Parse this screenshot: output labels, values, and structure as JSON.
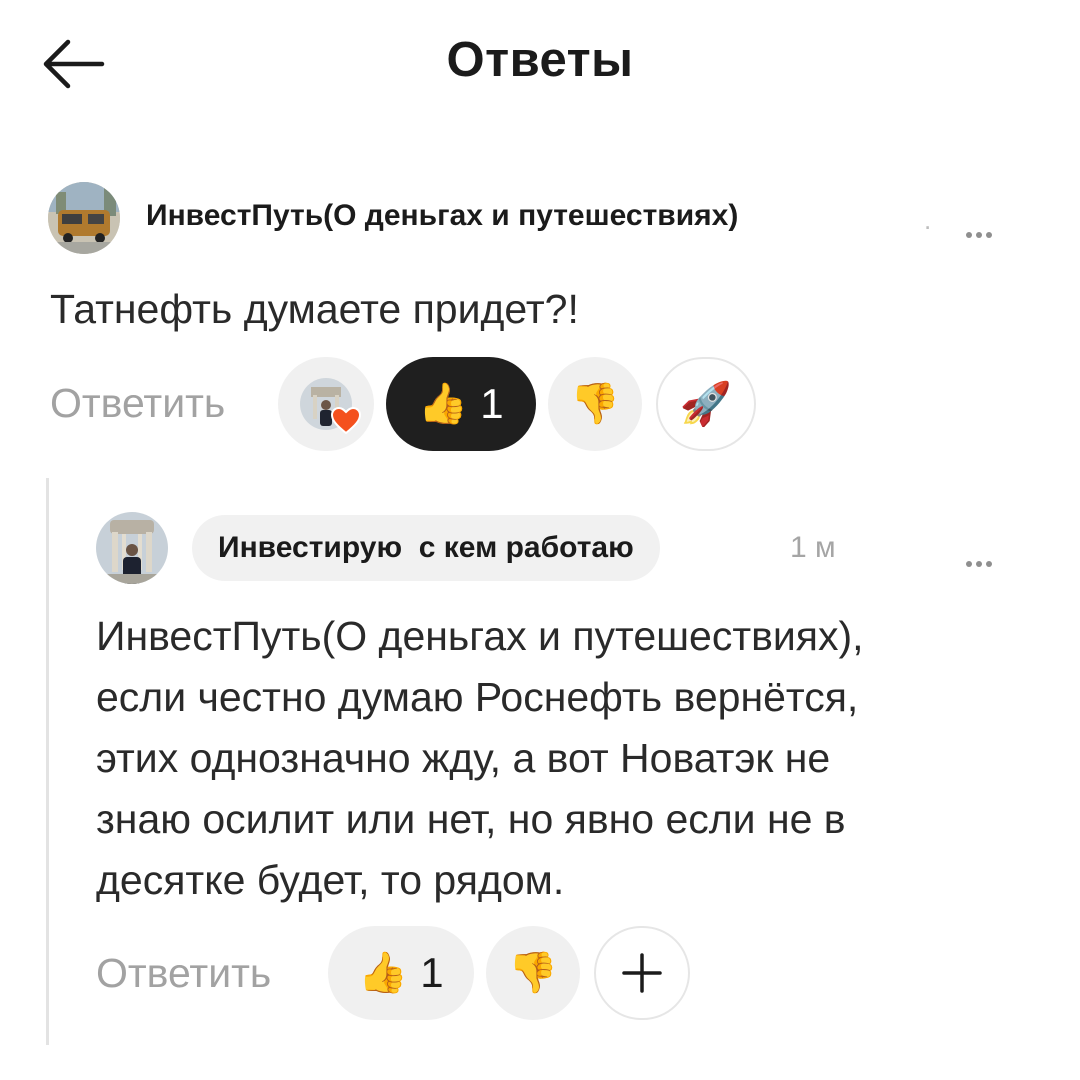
{
  "header": {
    "title": "Ответы"
  },
  "comment": {
    "author": "ИнвестПуть(О деньгах и путешествиях)",
    "author_suffix": ".",
    "text": "Татнефть думаете придет?!",
    "reply_label": "Ответить",
    "reactions": {
      "like_count": "1"
    }
  },
  "reply": {
    "author": "Инвестирую  с кем работаю",
    "time": "1 м",
    "text_lines": [
      "ИнвестПуть(О деньгах и путешествиях),",
      "если честно думаю Роснефть вернётся,",
      "этих однозначно жду, а вот Новатэк не",
      "знаю осилит или нет, но явно если не в",
      "десятке будет, то рядом."
    ],
    "reply_label": "Ответить",
    "reactions": {
      "like_count": "1"
    }
  },
  "colors": {
    "dark_chip": "#1f1f1f",
    "chip_bg": "#f0f0f0",
    "muted_text": "#a2a2a2",
    "heart": "#f4511e",
    "thumb": "#f7b500"
  },
  "icons": {
    "back": "arrow-left-icon",
    "like": "thumbs-up-emoji-icon",
    "dislike": "thumbs-down-emoji-icon",
    "rocket": "rocket-emoji-icon",
    "add": "plus-icon",
    "more": "more-dots-icon"
  }
}
